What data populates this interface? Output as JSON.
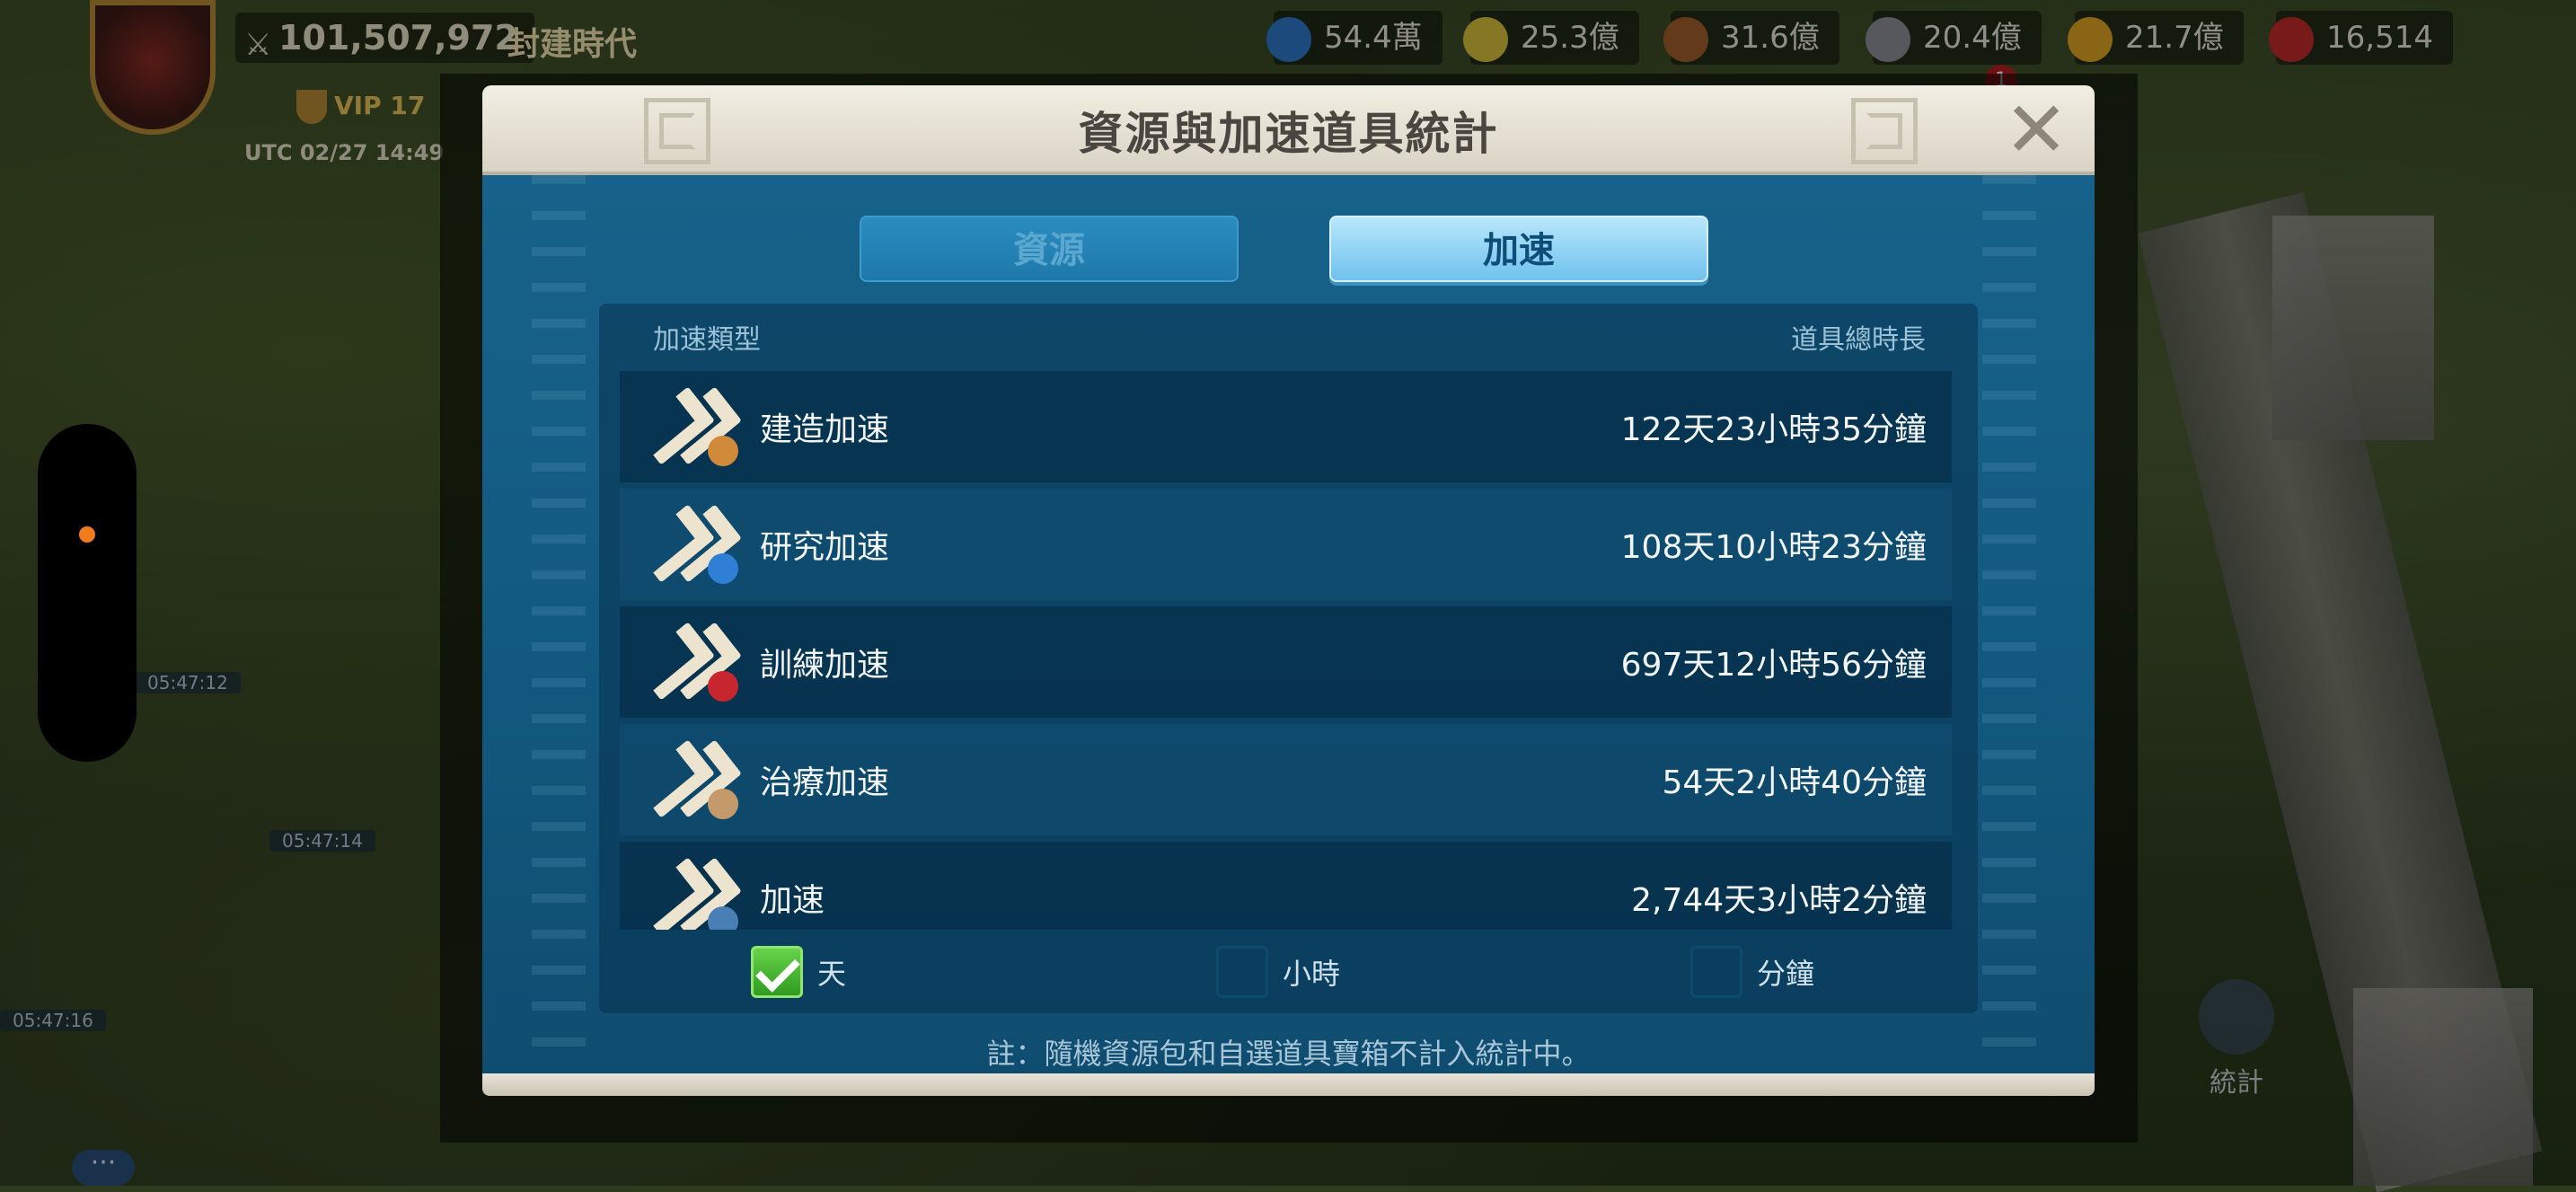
{
  "hud": {
    "power": "101,507,972",
    "era": "封建時代",
    "vip": "VIP 17",
    "utc": "UTC 02/27 14:49",
    "notification_count": "1",
    "resources": [
      {
        "name": "gems-icon",
        "value": "54.4萬",
        "color": "#2f78c8"
      },
      {
        "name": "food-icon",
        "value": "25.3億",
        "color": "#d7c13a"
      },
      {
        "name": "wood-icon",
        "value": "31.6億",
        "color": "#a0602c"
      },
      {
        "name": "stone-icon",
        "value": "20.4億",
        "color": "#8c8f96"
      },
      {
        "name": "gold-icon",
        "value": "21.7億",
        "color": "#e0a325"
      },
      {
        "name": "ruby-icon",
        "value": "16,514",
        "color": "#c22a2a"
      }
    ]
  },
  "city_timers": [
    "05:47:12",
    "05:47:14",
    "05:47:16"
  ],
  "stats_fab_label": "統計",
  "dialog": {
    "title": "資源與加速道具統計",
    "close_label": "✕",
    "tabs": {
      "resources": "資源",
      "speedups": "加速"
    },
    "active_tab": "speedups",
    "columns": {
      "type": "加速類型",
      "duration": "道具總時長"
    },
    "rows": [
      {
        "name": "建造加速",
        "duration": "122天23小時35分鐘",
        "icon": "construction-speedup-icon",
        "badge_color": "#d08a3a"
      },
      {
        "name": "研究加速",
        "duration": "108天10小時23分鐘",
        "icon": "research-speedup-icon",
        "badge_color": "#2f7fd6"
      },
      {
        "name": "訓練加速",
        "duration": "697天12小時56分鐘",
        "icon": "training-speedup-icon",
        "badge_color": "#c8262e"
      },
      {
        "name": "治療加速",
        "duration": "54天2小時40分鐘",
        "icon": "healing-speedup-icon",
        "badge_color": "#c49a6a"
      },
      {
        "name": "加速",
        "duration": "2,744天3小時2分鐘",
        "icon": "universal-speedup-icon",
        "badge_color": "#4a7fb5"
      }
    ],
    "units": {
      "days": {
        "label": "天",
        "checked": true
      },
      "hours": {
        "label": "小時",
        "checked": false
      },
      "minutes": {
        "label": "分鐘",
        "checked": false
      }
    },
    "note": "註：隨機資源包和自選道具寶箱不計入統計中。"
  },
  "colors": {
    "accent_tab_active": "#6fc2ee",
    "panel_blue": "#135a80",
    "header_cream": "#e4e0d3",
    "checkbox_green": "#3fae2c"
  }
}
